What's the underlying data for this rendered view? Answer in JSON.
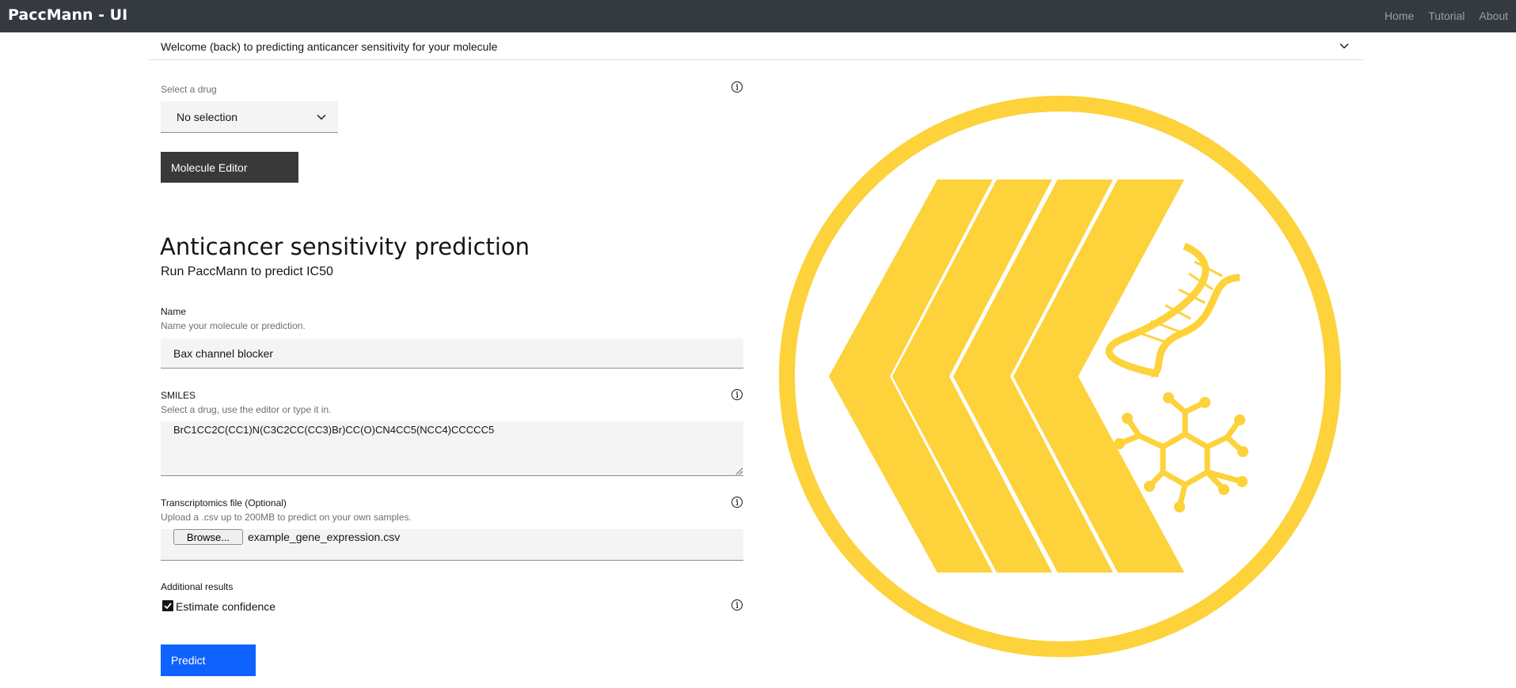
{
  "app": {
    "title": "PaccMann - UI",
    "nav": [
      "Home",
      "Tutorial",
      "About"
    ]
  },
  "accordion": {
    "title": "Welcome (back) to predicting anticancer sensitivity for your molecule"
  },
  "drug_select": {
    "label": "Select a drug",
    "value": "No selection"
  },
  "molecule_editor": {
    "label": "Molecule Editor"
  },
  "section": {
    "title": "Anticancer sensitivity prediction",
    "subtitle": "Run PaccMann to predict IC50"
  },
  "name_field": {
    "label": "Name",
    "help": "Name your molecule or prediction.",
    "value": "Bax channel blocker"
  },
  "smiles_field": {
    "label": "SMILES",
    "help": "Select a drug, use the editor or type it in.",
    "value": "BrC1CC2C(CC1)N(C3C2CC(CC3)Br)CC(O)CN4CC5(NCC4)CCCCC5"
  },
  "transcriptomics": {
    "label": "Transcriptomics file (Optional)",
    "help": "Upload a .csv up to 200MB to predict on your own samples.",
    "browse_label": "Browse...",
    "file_name": "example_gene_expression.csv"
  },
  "additional": {
    "label": "Additional results",
    "checkbox_label": "Estimate confidence",
    "checked": true
  },
  "predict_button": {
    "label": "Predict"
  },
  "colors": {
    "topbar": "#343a40",
    "primary": "#0f62fe",
    "logo_yellow": "#fdd23a",
    "dark_button": "#393939",
    "field_bg": "#f4f4f4"
  }
}
